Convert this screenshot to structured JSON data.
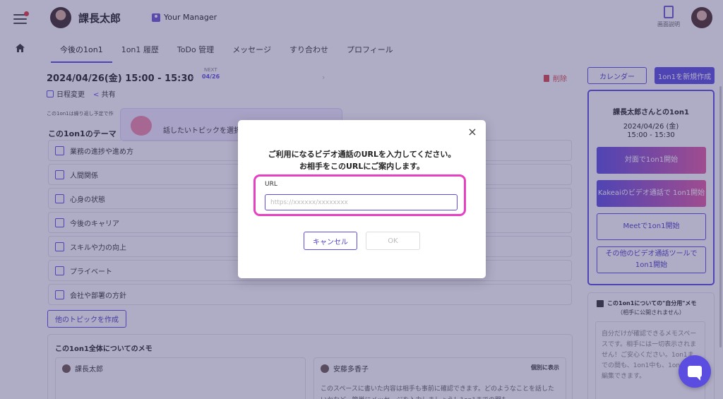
{
  "header": {
    "user_name": "課長太郎",
    "role": "Your Manager",
    "help_label": "画面説明"
  },
  "tabs": [
    {
      "label": "今後の1on1",
      "active": true
    },
    {
      "label": "1on1 履歴"
    },
    {
      "label": "ToDo 管理"
    },
    {
      "label": "メッセージ"
    },
    {
      "label": "すり合わせ"
    },
    {
      "label": "プロフィール"
    }
  ],
  "meeting": {
    "datetime": "2024/04/26(金)  15:00 - 15:30",
    "next_label": "NEXT",
    "next_date": "04/26",
    "prev_arrow": "‹",
    "next_arrow": "›",
    "delete_label": "削除",
    "reschedule_label": "日程変更",
    "share_label": "共有",
    "repeat_note": "この1on1は繰り返し予定で作"
  },
  "topic_tip": "話したいトピックを選択",
  "theme": {
    "title": "この1on1のテーマ",
    "topics": [
      "業務の進捗や進め方",
      "人間関係",
      "心身の状態",
      "今後のキャリア",
      "スキルや力の向上",
      "プライベート",
      "会社や部署の方針"
    ],
    "other_button": "他のトピックを作成"
  },
  "memo": {
    "title": "この1on1全体についてのメモ",
    "left_author": "課長太郎",
    "right_author": "安藤多香子",
    "individual_label": "個別に表示",
    "right_body": "このスペースに書いた内容は相手も事前に確認できます。どのようなことを話したいかなど、簡単にメッセージを入力しましょう！1on1までの間も"
  },
  "sidebar": {
    "calendar_button": "カレンダー",
    "new_button": "1on1を新規作成",
    "panel_title": "課長太郎さんとの1on1",
    "panel_date": "2024/04/26 (金)",
    "panel_time": "15:00 - 15:30",
    "start_face": "対面で1on1開始",
    "start_kakeai": "Kakeaiのビデオ通話で 1on1開始",
    "start_meet": "Meetで1on1開始",
    "start_other": "その他のビデオ通話ツールで 1on1開始",
    "self_memo_title": "この1on1についての\"自分用\"メモ",
    "self_memo_sub": "（相手に公開されません）",
    "self_memo_body": "自分だけが確認できるメモスペースです。相手には一切表示されません！ご安心ください。1on1までの間も、1on1中も、1on1後も編集できます。"
  },
  "modal": {
    "message_line1": "ご利用になるビデオ通話のURLを入力してください。",
    "message_line2": "お相手をこのURLにご案内します。",
    "url_label": "URL",
    "url_placeholder": "https://xxxxxx/xxxxxxxx",
    "url_value": "",
    "cancel_label": "キャンセル",
    "ok_label": "OK",
    "close_symbol": "×"
  },
  "colors": {
    "accent": "#5b4de0",
    "highlight": "#e640c3",
    "delete": "#d64b4b"
  }
}
